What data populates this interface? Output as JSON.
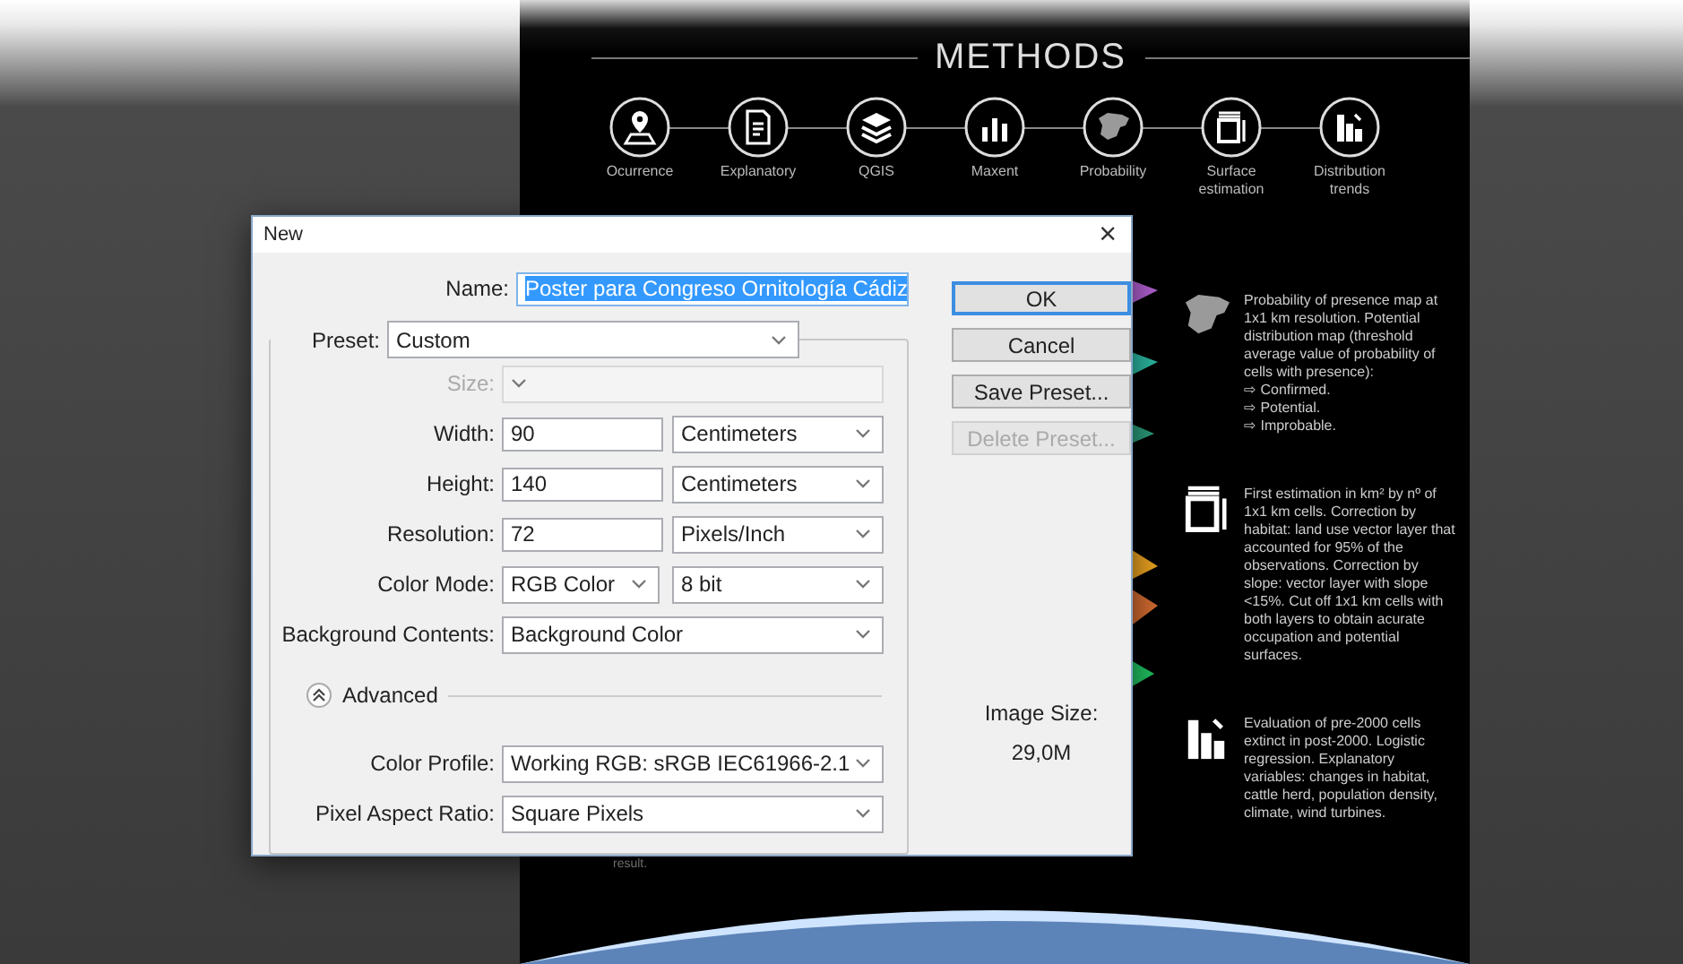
{
  "poster": {
    "title": "METHODS",
    "steps": [
      {
        "kind": "pin",
        "lines": [
          "Ocurrence"
        ]
      },
      {
        "kind": "document",
        "lines": [
          "Explanatory"
        ]
      },
      {
        "kind": "layers",
        "lines": [
          "QGIS"
        ]
      },
      {
        "kind": "bars",
        "lines": [
          "Maxent"
        ]
      },
      {
        "kind": "map",
        "lines": [
          "Probability"
        ]
      },
      {
        "kind": "frame",
        "lines": [
          "Surface",
          "estimation"
        ]
      },
      {
        "kind": "chart",
        "lines": [
          "Distribution",
          "trends"
        ]
      }
    ],
    "notes": [
      {
        "kind": "map",
        "text": "Probability of presence map at 1x1 km resolution. Potential distribution map (threshold average value of probability of cells with presence):",
        "bullets": [
          "⇨ Confirmed.",
          "⇨ Potential.",
          "⇨ Improbable."
        ]
      },
      {
        "kind": "frame",
        "text": "First estimation in km² by nº of 1x1 km cells. Correction by habitat: land use vector layer that accounted for 95% of the observations. Correction by slope: vector layer with slope <15%. Cut off 1x1 km cells with both layers to obtain acurate occupation and potential surfaces."
      },
      {
        "kind": "chart",
        "text": "Evaluation of pre-2000 cells extinct in post-2000. Logistic regression. Explanatory variables: changes in habitat, cattle herd, population density, climate, wind turbines."
      }
    ],
    "footnote": "result."
  },
  "dialog": {
    "title": "New",
    "close": "×",
    "name": {
      "label": "Name:",
      "value": "Poster para Congreso Ornitología Cádiz",
      "selected": true
    },
    "preset": {
      "label": "Preset:",
      "value": "Custom"
    },
    "rows": [
      {
        "kind": "select",
        "label": "Size:",
        "value": "",
        "disabled": true
      },
      {
        "kind": "number-unit",
        "label": "Width:",
        "value": "90",
        "unit": "Centimeters",
        "disabled": false
      },
      {
        "kind": "number-unit",
        "label": "Height:",
        "value": "140",
        "unit": "Centimeters",
        "disabled": false
      },
      {
        "kind": "number-unit",
        "label": "Resolution:",
        "value": "72",
        "unit": "Pixels/Inch",
        "disabled": false
      },
      {
        "kind": "select-pair",
        "label": "Color Mode:",
        "value": "RGB Color",
        "unit": "8 bit",
        "disabled": false
      },
      {
        "kind": "select",
        "label": "Background Contents:",
        "value": "Background Color",
        "disabled": false
      }
    ],
    "advanced": {
      "label": "Advanced",
      "expanded": true,
      "rows": [
        {
          "kind": "select",
          "label": "Color Profile:",
          "value": "Working RGB:  sRGB IEC61966-2.1",
          "disabled": false
        },
        {
          "kind": "select",
          "label": "Pixel Aspect Ratio:",
          "value": "Square Pixels",
          "disabled": false
        }
      ]
    },
    "buttons": [
      {
        "label": "OK",
        "default": true,
        "disabled": false
      },
      {
        "label": "Cancel",
        "default": false,
        "disabled": false
      },
      {
        "label": "Save Preset...",
        "default": false,
        "disabled": false
      },
      {
        "label": "Delete Preset...",
        "default": false,
        "disabled": true
      }
    ],
    "image_size": {
      "label": "Image Size:",
      "value": "29,0M"
    }
  }
}
